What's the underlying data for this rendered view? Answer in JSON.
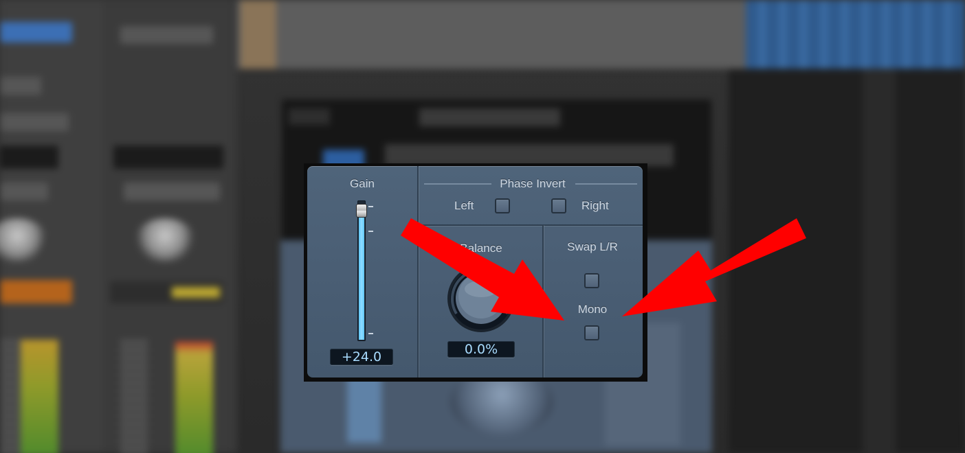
{
  "plugin": {
    "gain": {
      "label": "Gain",
      "value_text": "+24.0",
      "slider_level": 0.97
    },
    "phase_invert": {
      "label": "Phase Invert",
      "left_label": "Left",
      "right_label": "Right",
      "left_checked": false,
      "right_checked": false
    },
    "balance": {
      "label": "Balance",
      "value_text": "0.0%"
    },
    "swap": {
      "label": "Swap L/R",
      "checked": false
    },
    "mono": {
      "label": "Mono",
      "checked": false
    }
  },
  "annotation": {
    "arrow_color": "#ff0000",
    "target": "Mono"
  },
  "colors": {
    "panel": "#4f647a",
    "value_text": "#a9dcff",
    "slider_fill": "#5ec6ff"
  }
}
